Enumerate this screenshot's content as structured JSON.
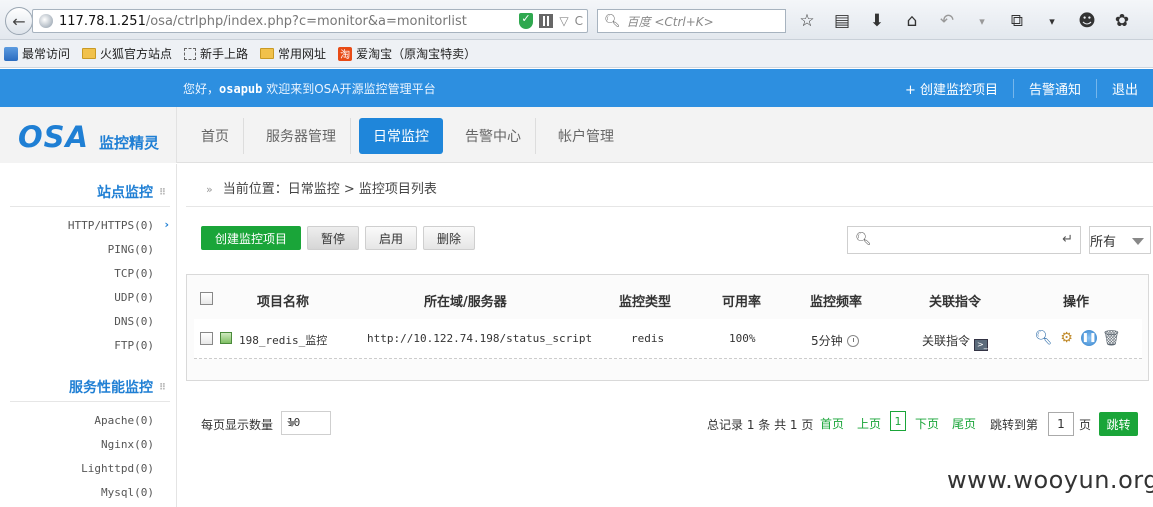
{
  "browser": {
    "url_host": "117.78.1.251",
    "url_rest": "/osa/ctrlphp/index.php?c=monitor&a=monitorlist",
    "search_placeholder": "百度 <Ctrl+K>",
    "bookmarks": [
      "最常访问",
      "火狐官方站点",
      "新手上路",
      "常用网址",
      "爱淘宝（原淘宝特卖）"
    ]
  },
  "topbar": {
    "greeting_prefix": "您好，",
    "username": "osapub",
    "greeting_suffix": " 欢迎来到OSA开源监控管理平台",
    "links": [
      "+ 创建监控项目",
      "告警通知",
      "退出"
    ]
  },
  "logo": {
    "brand": "OSA",
    "subtitle": "监控精灵"
  },
  "nav": {
    "tabs": [
      "首页",
      "服务器管理",
      "日常监控",
      "告警中心",
      "帐户管理"
    ],
    "active_index": 2
  },
  "sidebar": {
    "site_title": "站点监控",
    "site_items": [
      "HTTP/HTTPS(0)",
      "PING(0)",
      "TCP(0)",
      "UDP(0)",
      "DNS(0)",
      "FTP(0)"
    ],
    "perf_title": "服务性能监控",
    "perf_items": [
      "Apache(0)",
      "Nginx(0)",
      "Lighttpd(0)",
      "Mysql(0)"
    ]
  },
  "breadcrumb": "当前位置：日常监控 > 监控项目列表",
  "toolbar": {
    "create": "创建监控项目",
    "pause": "暂停",
    "enable": "启用",
    "delete": "删除",
    "filter_value": "所有"
  },
  "table": {
    "headers": [
      "项目名称",
      "所在域/服务器",
      "监控类型",
      "可用率",
      "监控频率",
      "关联指令",
      "操作"
    ],
    "rows": [
      {
        "name": "198_redis_监控",
        "server": "http://10.122.74.198/status_script",
        "type": "redis",
        "availability": "100%",
        "frequency": "5分钟",
        "command": "关联指令"
      }
    ]
  },
  "pager": {
    "per_page_label": "每页显示数量",
    "per_page_value": "10",
    "summary": "总记录 1 条 共 1 页",
    "first": "首页",
    "prev": "上页",
    "current": "1",
    "next": "下页",
    "last": "尾页",
    "jump_label": "跳转到第",
    "jump_value": "1",
    "jump_unit": "页",
    "jump_button": "跳转"
  },
  "watermark": "www.wooyun.org"
}
